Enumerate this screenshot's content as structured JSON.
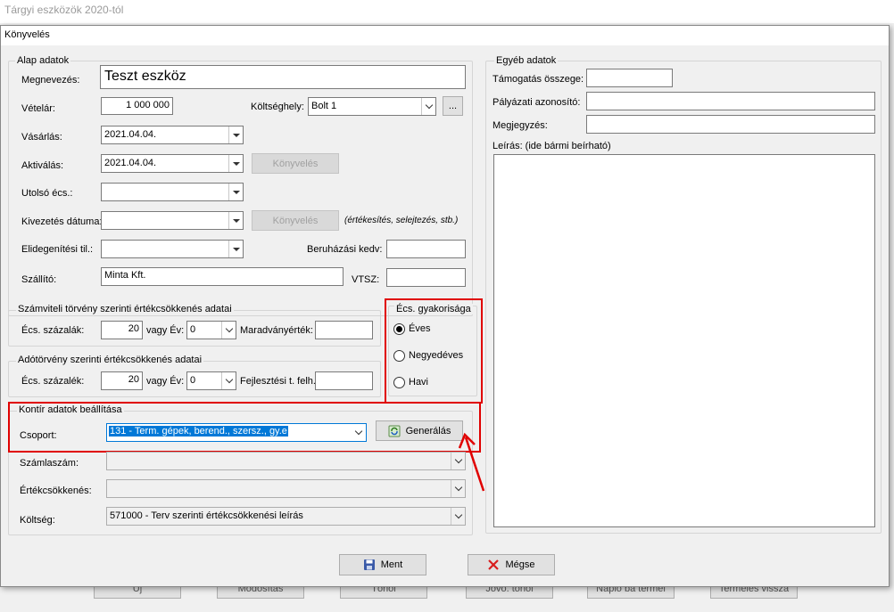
{
  "background": {
    "window_title": "Tárgyi eszközök 2020-tól",
    "buttons": [
      "Új",
      "Módosítás",
      "Törlöl",
      "Jövő. törlöl",
      "Napló ba termel",
      "Termelés vissza"
    ]
  },
  "dialog": {
    "title": "Könyvelés",
    "alap": {
      "group_title": "Alap adatok",
      "megnevezes_label": "Megnevezés:",
      "megnevezes_value": "Teszt eszköz",
      "vetelar_label": "Vételár:",
      "vetelar_value": "1 000 000",
      "koltseghely_label": "Költséghely:",
      "koltseghely_value": "Bolt 1",
      "browse_label": "...",
      "vasarlas_label": "Vásárlás:",
      "vasarlas_value": "2021.04.04.",
      "aktivalas_label": "Aktiválás:",
      "aktivalas_value": "2021.04.04.",
      "konyveles_btn": "Könyvelés",
      "utolso_label": "Utolsó écs.:",
      "kivezetes_label": "Kivezetés dátuma:",
      "kivezetes_note": "(értékesítés, selejtezés, stb.)",
      "elidegenitesi_label": "Elidegenítési til.:",
      "beruhazasi_label": "Beruházási kedv:",
      "szallito_label": "Szállító:",
      "szallito_value": "Minta Kft.",
      "vtsz_label": "VTSZ:"
    },
    "szamviteli": {
      "group_title": "Számviteli törvény szerinti értékcsökkenés adatai",
      "szazalek_label": "Écs. százalák:",
      "szazalek_value": "20",
      "vagy_ev_label": "vagy Év:",
      "ev_value": "0",
      "maradvany_label": "Maradványérték:"
    },
    "adotorveny": {
      "group_title": "Adótörvény szerinti értékcsökkenés adatai",
      "szazalek_label": "Écs. százalék:",
      "szazalek_value": "20",
      "vagy_ev_label": "vagy Év:",
      "ev_value": "0",
      "fejlesztesi_label": "Fejlesztési t. felh.:"
    },
    "gyakorisag": {
      "group_title": "Écs. gyakorisága",
      "options": [
        "Éves",
        "Negyedéves",
        "Havi"
      ],
      "selected": "Éves"
    },
    "kontir": {
      "group_title": "Kontír adatok beállítása",
      "csoport_label": "Csoport:",
      "csoport_value": "131 - Term. gépek, berend., szersz., gy.e",
      "generalas_btn": "Generálás",
      "szamlaszam_label": "Számlaszám:",
      "ertekcsokkenes_label": "Értékcsökkenés:",
      "koltseg_label": "Költség:",
      "koltseg_value": "571000 - Terv szerinti értékcsökkenési leírás"
    },
    "egyeb": {
      "group_title": "Egyéb adatok",
      "tamogatas_label": "Támogatás összege:",
      "palyazati_label": "Pályázati azonosító:",
      "megjegyzes_label": "Megjegyzés:",
      "leiras_label": "Leírás: (ide bármi beírható)"
    },
    "ment_btn": "Ment",
    "megse_btn": "Mégse"
  },
  "colors": {
    "highlight_red": "#e00000",
    "selection_blue": "#0078d7"
  }
}
